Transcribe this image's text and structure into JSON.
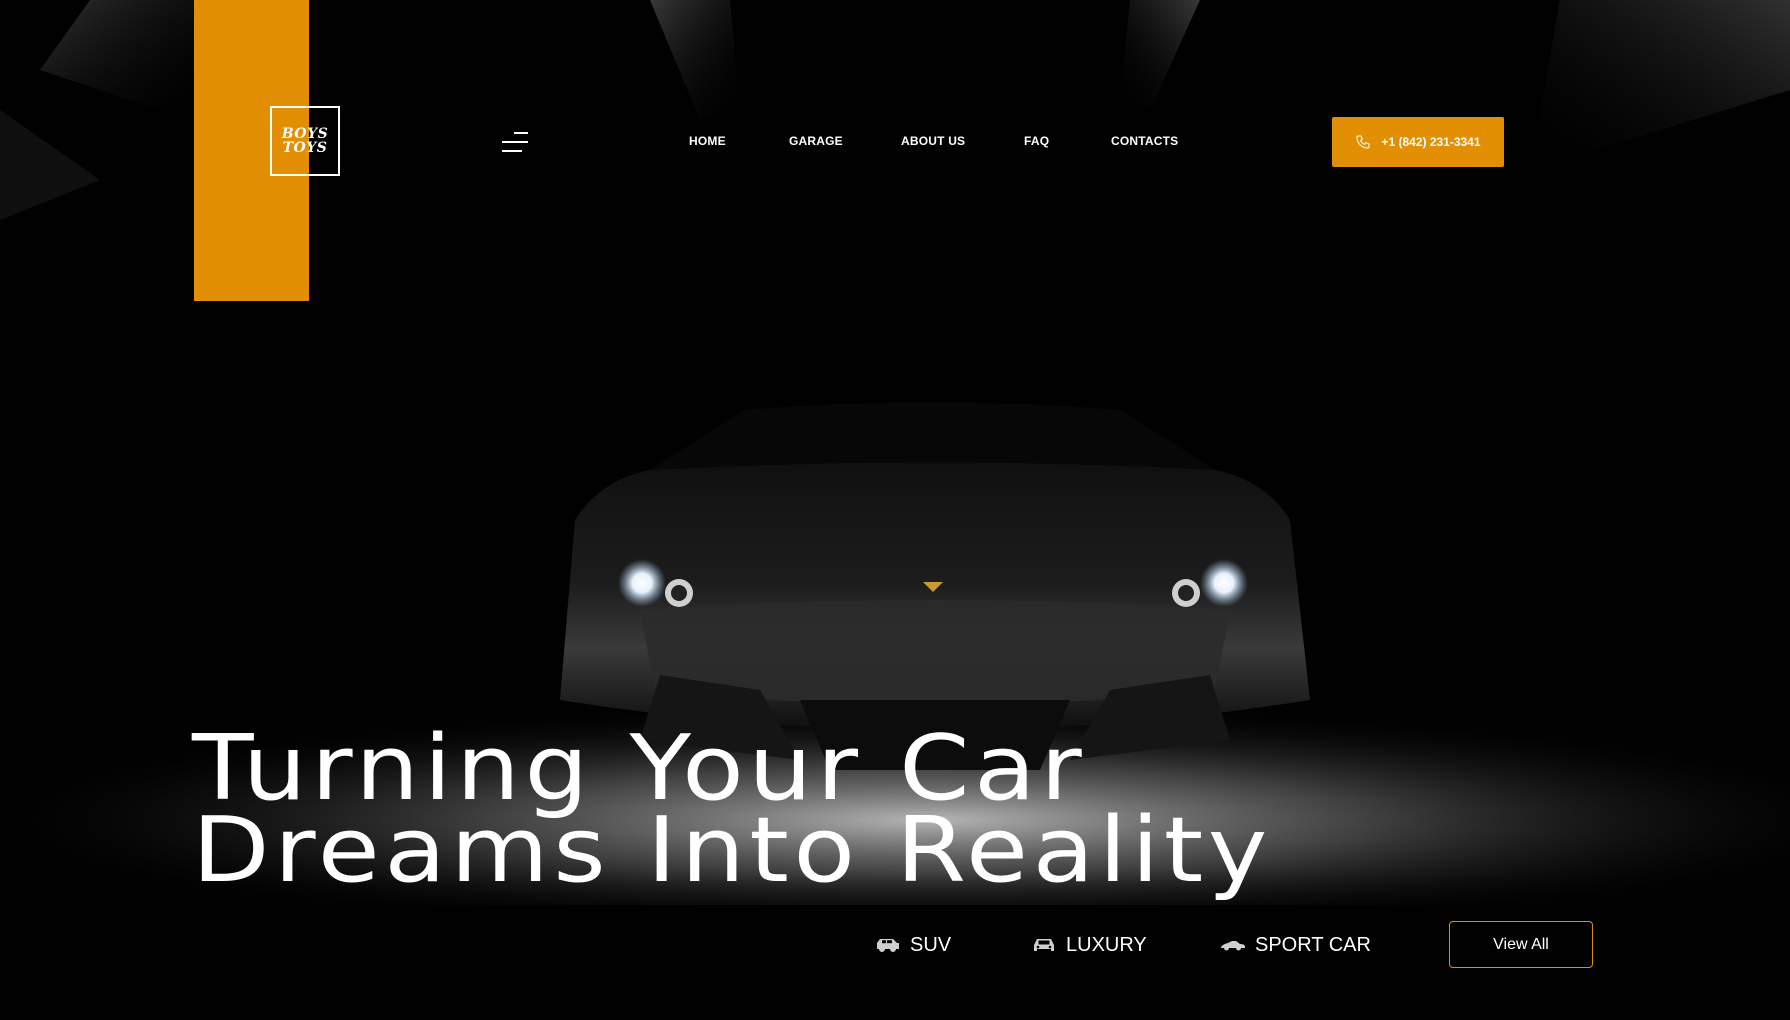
{
  "brand": {
    "logo_line1": "BOYS",
    "logo_line2": "TOYS",
    "accent_color": "#e38f04"
  },
  "header": {
    "menu_icon": "hamburger-menu-icon",
    "nav": [
      {
        "label": "HOME"
      },
      {
        "label": "GARAGE"
      },
      {
        "label": "ABOUT US"
      },
      {
        "label": "FAQ"
      },
      {
        "label": "CONTACTS"
      }
    ],
    "phone": {
      "icon": "phone-icon",
      "label": "+1 (842) 231-3341"
    }
  },
  "hero": {
    "headline_line1": "Turning Your Car",
    "headline_line2": "Dreams Into Reality",
    "background": "dark-garage-sports-car-photo"
  },
  "categories": {
    "items": [
      {
        "label": "SUV",
        "icon": "suv-icon"
      },
      {
        "label": "LUXURY",
        "icon": "luxury-car-icon"
      },
      {
        "label": "SPORT CAR",
        "icon": "sport-car-icon"
      }
    ],
    "view_all": "View All"
  }
}
